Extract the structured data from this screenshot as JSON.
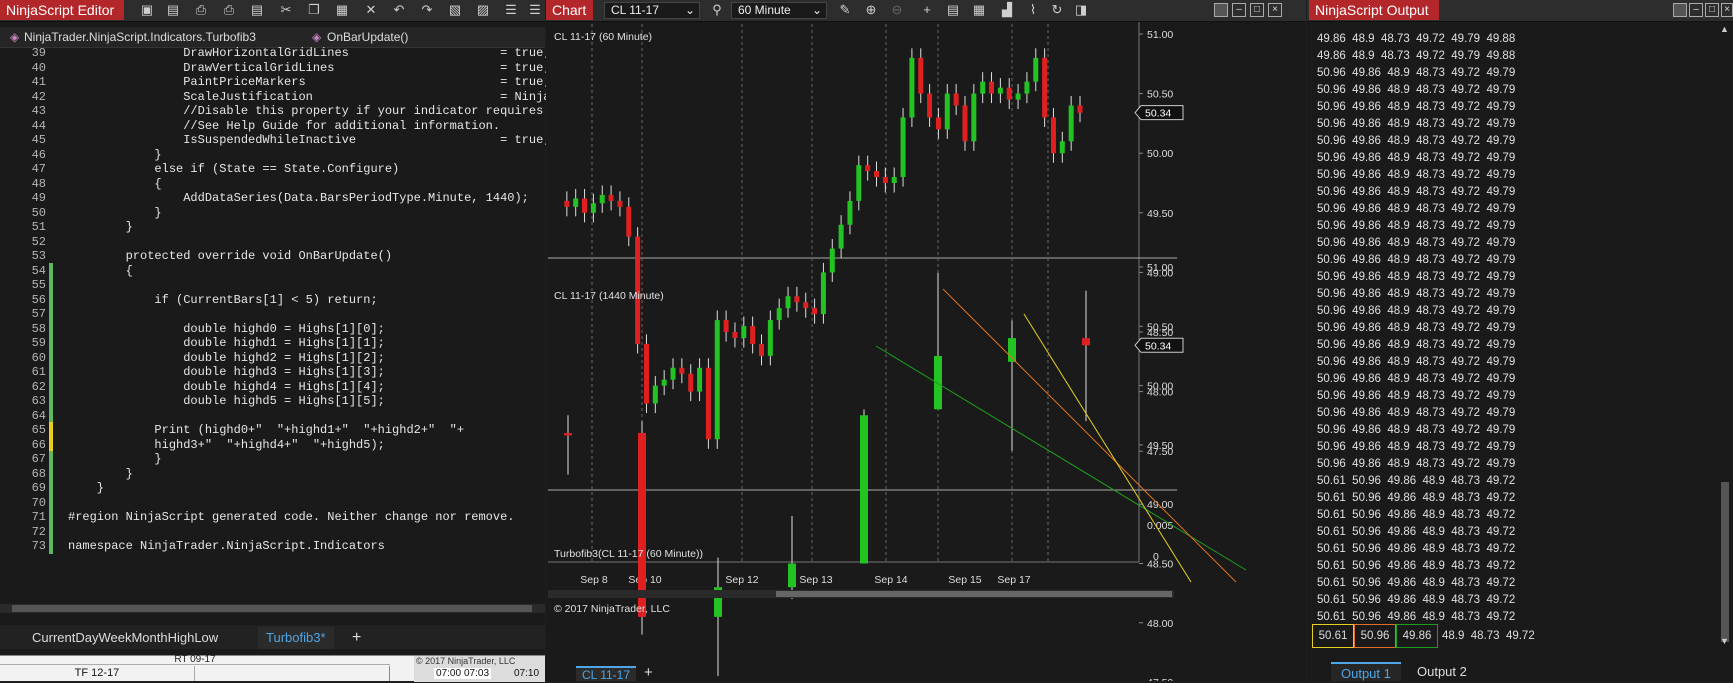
{
  "editor": {
    "title": "NinjaScript Editor",
    "breadcrumb_class": "NinjaTrader.NinjaScript.Indicators.Turbofib3",
    "breadcrumb_method": "OnBarUpdate()",
    "lines": [
      {
        "n": "39",
        "t": "                DrawHorizontalGridLines                     = true;"
      },
      {
        "n": "40",
        "t": "                DrawVerticalGridLines                       = true;"
      },
      {
        "n": "41",
        "t": "                PaintPriceMarkers                           = true;"
      },
      {
        "n": "42",
        "t": "                ScaleJustification                          = NinjaT"
      },
      {
        "n": "43",
        "t": "                //Disable this property if your indicator requires c"
      },
      {
        "n": "44",
        "t": "                //See Help Guide for additional information."
      },
      {
        "n": "45",
        "t": "                IsSuspendedWhileInactive                    = true;"
      },
      {
        "n": "46",
        "t": "            }"
      },
      {
        "n": "47",
        "t": "            else if (State == State.Configure)"
      },
      {
        "n": "48",
        "t": "            {"
      },
      {
        "n": "49",
        "t": "                AddDataSeries(Data.BarsPeriodType.Minute, 1440);"
      },
      {
        "n": "50",
        "t": "            }"
      },
      {
        "n": "51",
        "t": "        }"
      },
      {
        "n": "52",
        "t": ""
      },
      {
        "n": "53",
        "t": "        protected override void OnBarUpdate()"
      },
      {
        "n": "54",
        "t": "        {"
      },
      {
        "n": "55",
        "t": ""
      },
      {
        "n": "56",
        "t": "            if (CurrentBars[1] < 5) return;"
      },
      {
        "n": "57",
        "t": ""
      },
      {
        "n": "58",
        "t": "                double highd0 = Highs[1][0];"
      },
      {
        "n": "59",
        "t": "                double highd1 = Highs[1][1];"
      },
      {
        "n": "60",
        "t": "                double highd2 = Highs[1][2];"
      },
      {
        "n": "61",
        "t": "                double highd3 = Highs[1][3];"
      },
      {
        "n": "62",
        "t": "                double highd4 = Highs[1][4];"
      },
      {
        "n": "63",
        "t": "                double highd5 = Highs[1][5];"
      },
      {
        "n": "64",
        "t": ""
      },
      {
        "n": "65",
        "t": "            Print (highd0+\"  \"+highd1+\"  \"+highd2+\"  \"+"
      },
      {
        "n": "66",
        "t": "            highd3+\"  \"+highd4+\"  \"+highd5);"
      },
      {
        "n": "67",
        "t": "            }"
      },
      {
        "n": "68",
        "t": "        }"
      },
      {
        "n": "69",
        "t": "    }"
      },
      {
        "n": "70",
        "t": ""
      },
      {
        "n": "71",
        "t": "#region NinjaScript generated code. Neither change nor remove."
      },
      {
        "n": "72",
        "t": ""
      },
      {
        "n": "73",
        "t": "namespace NinjaTrader.NinjaScript.Indicators"
      }
    ],
    "tabs": [
      "CurrentDayWeekMonthHighLow",
      "Turbofib3*"
    ],
    "add_tab": "+",
    "grid_cell": "TF 12-17",
    "grid_cell2": "RT 09-17",
    "grid_cells_right": [
      "07:00",
      "07:03",
      "07:10"
    ],
    "grid_header_right": "© 2017 NinjaTrader, LLC"
  },
  "chart": {
    "title": "Chart",
    "instrument": "CL 11-17",
    "period": "60 Minute",
    "panel1_label": "CL 11-17 (60 Minute)",
    "panel2_label": "CL 11-17 (1440 Minute)",
    "panel3_label": "Turbofib3(CL 11-17 (60 Minute))",
    "copyright": "© 2017 NinjaTrader, LLC",
    "price_marker": "50.34",
    "panel1_axis": [
      "51.00",
      "50.50",
      "50.00",
      "49.50",
      "49.00",
      "48.50",
      "48.00",
      "47.50"
    ],
    "panel2_axis": [
      "51.00",
      "50.50",
      "50.00",
      "49.50",
      "49.00",
      "48.50",
      "48.00",
      "47.50"
    ],
    "panel3_axis": [
      "0.005",
      "0"
    ],
    "x_axis": [
      "Sep 8",
      "Sep 10",
      "Sep 12",
      "Sep 13",
      "Sep 14",
      "Sep 15",
      "Sep 17"
    ],
    "bottom_tab": "CL 11-17",
    "colors": {
      "up": "#22c322",
      "down": "#e02020",
      "line_green": "#1e9e1e",
      "line_orange": "#e07020",
      "line_yellow": "#e8d020"
    }
  },
  "chart_data": {
    "type": "candlestick",
    "daily": [
      {
        "x": "Sep 8",
        "o": 49.6,
        "h": 49.75,
        "l": 49.25,
        "c": 49.58
      },
      {
        "x": "Sep 10",
        "o": 49.6,
        "h": 49.7,
        "l": 47.9,
        "c": 48.05
      },
      {
        "x": "Sep 12",
        "o": 48.05,
        "h": 48.55,
        "l": 47.55,
        "c": 48.3
      },
      {
        "x": "Sep 12b",
        "o": 48.3,
        "h": 48.9,
        "l": 48.2,
        "c": 48.5
      },
      {
        "x": "Sep 13",
        "o": 48.5,
        "h": 49.8,
        "l": 48.6,
        "c": 49.75
      },
      {
        "x": "Sep 14",
        "o": 49.8,
        "h": 50.95,
        "l": 49.8,
        "c": 50.25
      },
      {
        "x": "Sep 15",
        "o": 50.2,
        "h": 50.55,
        "l": 49.45,
        "c": 50.4
      },
      {
        "x": "Sep 17",
        "o": 50.4,
        "h": 50.8,
        "l": 49.7,
        "c": 50.34
      }
    ],
    "hourly_close_path": [
      49.6,
      49.55,
      49.62,
      49.5,
      49.58,
      49.65,
      49.6,
      49.55,
      49.3,
      48.4,
      47.9,
      48.05,
      48.1,
      48.2,
      48.15,
      48.0,
      48.2,
      47.6,
      48.6,
      48.5,
      48.45,
      48.55,
      48.4,
      48.3,
      48.6,
      48.7,
      48.8,
      48.75,
      48.7,
      48.65,
      49.0,
      49.2,
      49.4,
      49.6,
      49.9,
      49.85,
      49.8,
      49.75,
      49.8,
      50.3,
      50.8,
      50.5,
      50.3,
      50.2,
      50.5,
      50.4,
      50.1,
      50.5,
      50.6,
      50.5,
      50.55,
      50.45,
      50.5,
      50.6,
      50.8,
      50.3,
      50.0,
      50.1,
      50.4,
      50.34
    ],
    "ylim": [
      47.25,
      51.1
    ]
  },
  "output": {
    "title": "NinjaScript Output",
    "rows": [
      "49.86  48.9  48.73  49.72  49.79  49.88",
      "49.86  48.9  48.73  49.72  49.79  49.88",
      "50.96  49.86  48.9  48.73  49.72  49.79",
      "50.96  49.86  48.9  48.73  49.72  49.79",
      "50.96  49.86  48.9  48.73  49.72  49.79",
      "50.96  49.86  48.9  48.73  49.72  49.79",
      "50.96  49.86  48.9  48.73  49.72  49.79",
      "50.96  49.86  48.9  48.73  49.72  49.79",
      "50.96  49.86  48.9  48.73  49.72  49.79",
      "50.96  49.86  48.9  48.73  49.72  49.79",
      "50.96  49.86  48.9  48.73  49.72  49.79",
      "50.96  49.86  48.9  48.73  49.72  49.79",
      "50.96  49.86  48.9  48.73  49.72  49.79",
      "50.96  49.86  48.9  48.73  49.72  49.79",
      "50.96  49.86  48.9  48.73  49.72  49.79",
      "50.96  49.86  48.9  48.73  49.72  49.79",
      "50.96  49.86  48.9  48.73  49.72  49.79",
      "50.96  49.86  48.9  48.73  49.72  49.79",
      "50.96  49.86  48.9  48.73  49.72  49.79",
      "50.96  49.86  48.9  48.73  49.72  49.79",
      "50.96  49.86  48.9  48.73  49.72  49.79",
      "50.96  49.86  48.9  48.73  49.72  49.79",
      "50.96  49.86  48.9  48.73  49.72  49.79",
      "50.96  49.86  48.9  48.73  49.72  49.79",
      "50.96  49.86  48.9  48.73  49.72  49.79",
      "50.96  49.86  48.9  48.73  49.72  49.79",
      "50.61  50.96  49.86  48.9  48.73  49.72",
      "50.61  50.96  49.86  48.9  48.73  49.72",
      "50.61  50.96  49.86  48.9  48.73  49.72",
      "50.61  50.96  49.86  48.9  48.73  49.72",
      "50.61  50.96  49.86  48.9  48.73  49.72",
      "50.61  50.96  49.86  48.9  48.73  49.72",
      "50.61  50.96  49.86  48.9  48.73  49.72",
      "50.61  50.96  49.86  48.9  48.73  49.72",
      "50.61  50.96  49.86  48.9  48.73  49.72"
    ],
    "last_row": [
      "50.61",
      "50.96",
      "49.86",
      "48.9  48.73  49.72"
    ],
    "tabs": [
      "Output 1",
      "Output 2"
    ]
  }
}
